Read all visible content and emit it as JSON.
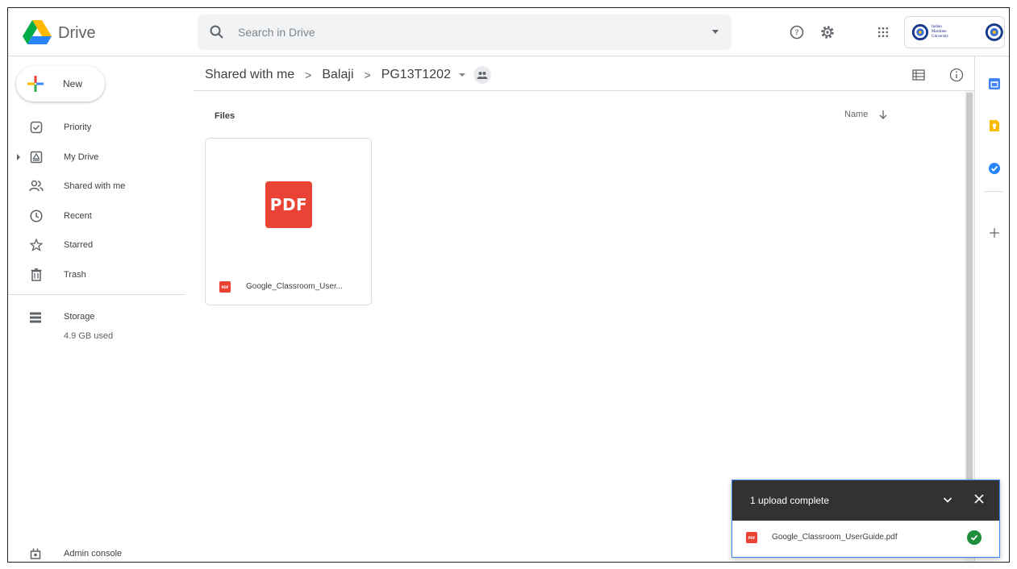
{
  "header": {
    "app_name": "Drive",
    "search_placeholder": "Search in Drive",
    "icons": [
      "drive-logo",
      "search-icon",
      "dropdown-icon",
      "help-icon",
      "settings-icon",
      "apps-grid-icon",
      "org-logo",
      "account-avatar"
    ],
    "org_logo_text": "Indian Maritime University"
  },
  "sidebar": {
    "new_label": "New",
    "items": [
      {
        "label": "Priority",
        "icon": "priority-icon"
      },
      {
        "label": "My Drive",
        "icon": "my-drive-icon",
        "expandable": true
      },
      {
        "label": "Shared with me",
        "icon": "shared-icon"
      },
      {
        "label": "Recent",
        "icon": "clock-icon"
      },
      {
        "label": "Starred",
        "icon": "star-icon"
      },
      {
        "label": "Trash",
        "icon": "trash-icon"
      }
    ],
    "storage_label": "Storage",
    "storage_used": "4.9 GB used",
    "admin_label": "Admin console"
  },
  "breadcrumb": {
    "items": [
      "Shared with me",
      "Balaji",
      "PG13T1202"
    ],
    "separator": ">"
  },
  "content": {
    "section_label": "Files",
    "sort_label": "Name",
    "files": [
      {
        "name": "Google_Classroom_User...",
        "type_label": "PDF"
      }
    ]
  },
  "upload_toast": {
    "title": "1 upload complete",
    "file_name": "Google_Classroom_UserGuide.pdf",
    "status": "complete"
  },
  "colors": {
    "pdf_red": "#ea4335",
    "toast_header": "#323232",
    "success_green": "#1e8e3e",
    "accent_blue": "#4285f4"
  }
}
